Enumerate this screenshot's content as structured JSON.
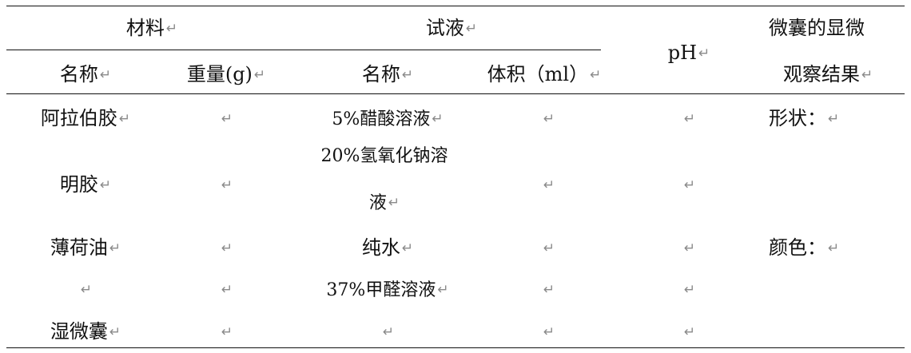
{
  "table": {
    "header": {
      "materials": "材料",
      "reagent": "试液",
      "ph": "pH",
      "result_l1": "微囊的显微",
      "result_l2": "观察结果",
      "name1": "名称",
      "weight": "重量(g)",
      "name2": "名称",
      "volume": "体积（ml）"
    },
    "rows": [
      {
        "material": "阿拉伯胶",
        "reagent": "5%醋酸溶液",
        "result": "形状："
      },
      {
        "material": "明胶",
        "reagent_l1": "20%氢氧化钠溶",
        "reagent_l2": "液"
      },
      {
        "material": "薄荷油",
        "reagent": "纯水",
        "result": "颜色："
      },
      {
        "reagent": "37%甲醛溶液"
      },
      {
        "material": "湿微囊"
      }
    ],
    "paragraph_mark": "↵"
  }
}
